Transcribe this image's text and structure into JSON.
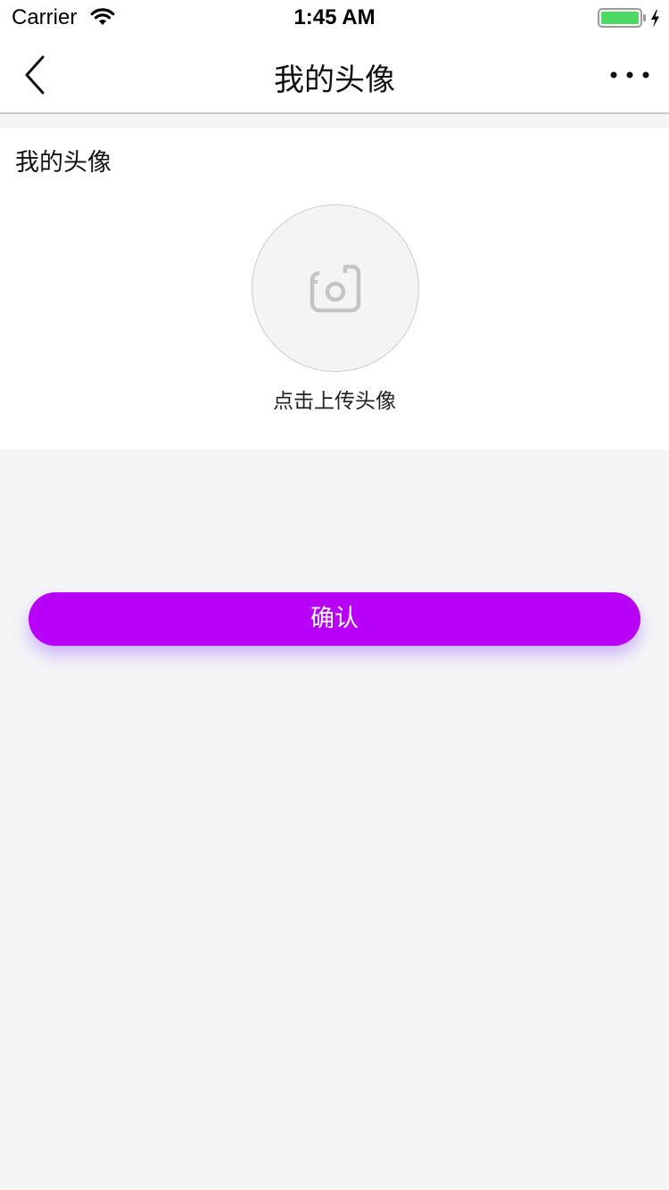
{
  "status_bar": {
    "carrier": "Carrier",
    "time": "1:45 AM",
    "battery_color": "#4cd964"
  },
  "nav": {
    "title": "我的头像",
    "back_icon": "chevron-left-icon",
    "more_icon": "more-horizontal-icon"
  },
  "avatar_section": {
    "title": "我的头像",
    "upload_hint": "点击上传头像",
    "camera_icon": "camera-icon"
  },
  "confirm_button": {
    "label": "确认",
    "color": "#b800f8"
  }
}
